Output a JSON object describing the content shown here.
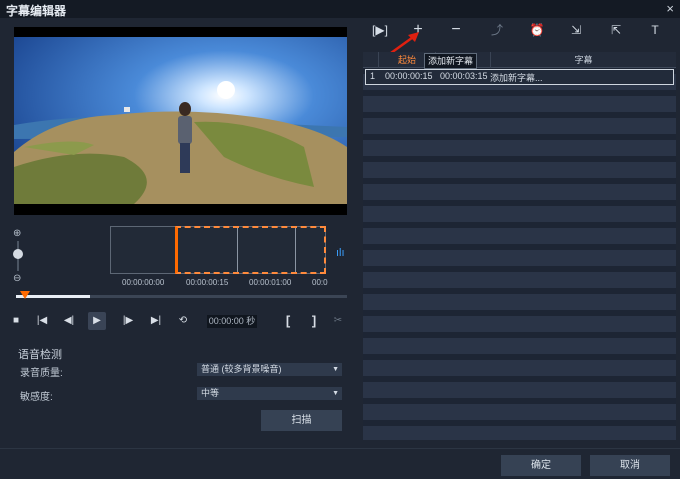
{
  "window": {
    "title": "字幕编辑器",
    "close": "×"
  },
  "timeline": {
    "times": [
      "00:00:00:00",
      "00:00:00:15",
      "00:00:01:00",
      "00:0"
    ]
  },
  "transport": {
    "timecode": "00:00:00",
    "timecode_unit": "秒",
    "mark_in": "[",
    "mark_out": "]"
  },
  "voice_detection": {
    "title": "语音检测",
    "quality_label": "录音质量:",
    "quality_value": "普通 (较多背景噪音)",
    "sensitivity_label": "敏感度:",
    "sensitivity_value": "中等",
    "scan_button": "扫描"
  },
  "toolbar": {
    "tooltip": "添加新字幕"
  },
  "subtitle_list": {
    "headers": [
      "起始",
      "字幕"
    ],
    "rows": [
      {
        "index": "1",
        "start": "00:00:00:15",
        "end": "00:00:03:15",
        "text": "添加新字幕..."
      }
    ]
  },
  "footer": {
    "ok": "确定",
    "cancel": "取消"
  }
}
